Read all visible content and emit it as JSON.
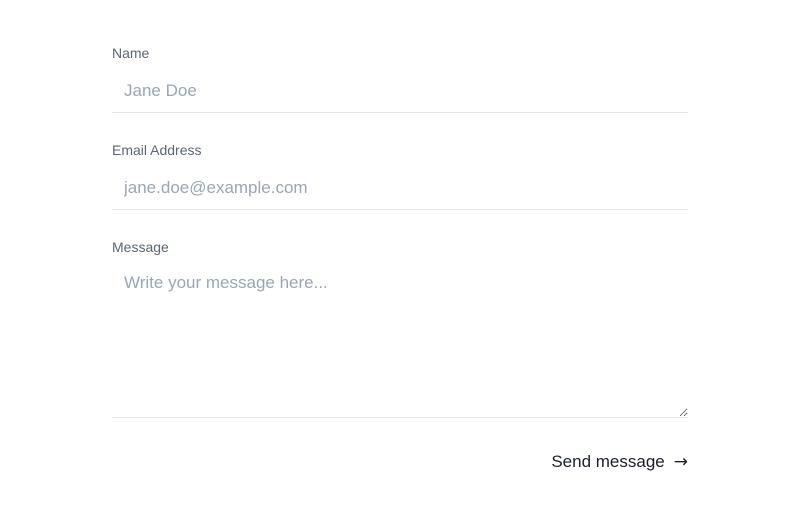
{
  "form": {
    "name_label": "Name",
    "name_placeholder": "Jane Doe",
    "name_value": "",
    "email_label": "Email Address",
    "email_placeholder": "jane.doe@example.com",
    "email_value": "",
    "message_label": "Message",
    "message_placeholder": "Write your message here...",
    "message_value": "",
    "send_label": "Send message",
    "send_icon": "arrow-right-icon",
    "send_glyph": "→"
  },
  "colors": {
    "label": "#5b6677",
    "placeholder": "#9aa6b6",
    "divider": "#e3e6ea",
    "button_text": "#1a1f2b",
    "background": "#ffffff"
  }
}
